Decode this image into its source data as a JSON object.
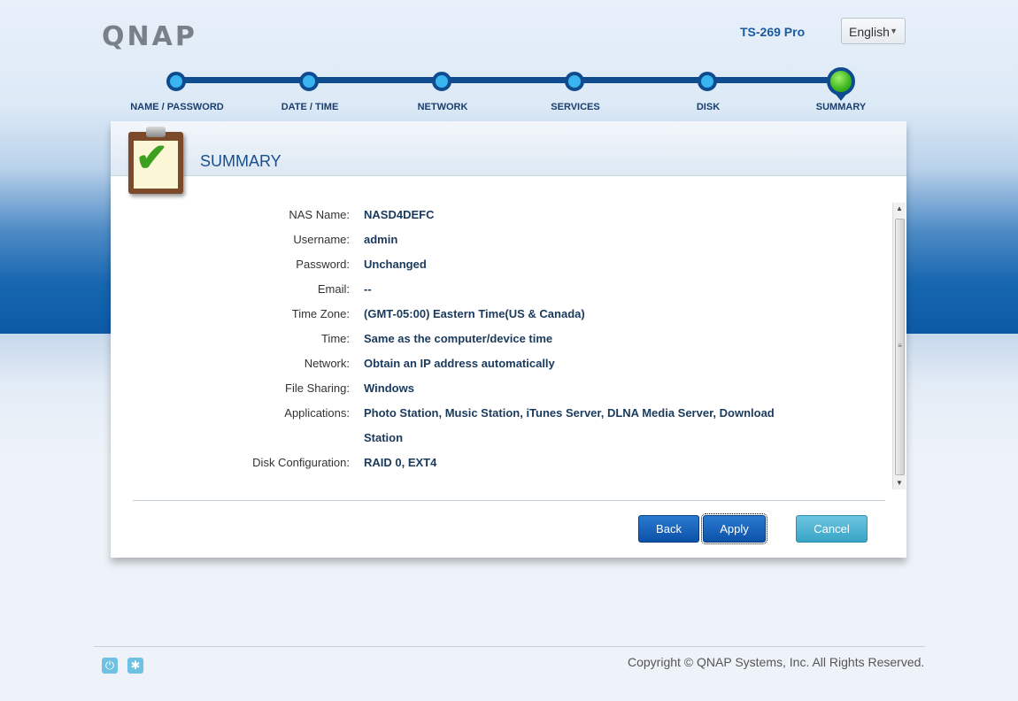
{
  "header": {
    "logo_text": "QNAP",
    "model": "TS-269 Pro",
    "language": "English"
  },
  "steps": [
    {
      "label": "NAME / PASSWORD",
      "active": false
    },
    {
      "label": "DATE / TIME",
      "active": false
    },
    {
      "label": "NETWORK",
      "active": false
    },
    {
      "label": "SERVICES",
      "active": false
    },
    {
      "label": "DISK",
      "active": false
    },
    {
      "label": "SUMMARY",
      "active": true
    }
  ],
  "panel": {
    "title": "SUMMARY",
    "icon": "clipboard-check-icon"
  },
  "summary": [
    {
      "label": "NAS Name:",
      "value": "NASD4DEFC"
    },
    {
      "label": "Username:",
      "value": "admin"
    },
    {
      "label": "Password:",
      "value": "Unchanged"
    },
    {
      "label": "Email:",
      "value": "--"
    },
    {
      "label": "Time Zone:",
      "value": "(GMT-05:00) Eastern Time(US & Canada)"
    },
    {
      "label": "Time:",
      "value": "Same as the computer/device time"
    },
    {
      "label": "Network:",
      "value": "Obtain an IP address automatically"
    },
    {
      "label": "File Sharing:",
      "value": "Windows"
    },
    {
      "label": "Applications:",
      "value": "Photo Station, Music Station, iTunes Server, DLNA Media Server, Download Station"
    },
    {
      "label": "Disk Configuration:",
      "value": "RAID 0, EXT4"
    }
  ],
  "buttons": {
    "back": "Back",
    "apply": "Apply",
    "cancel": "Cancel"
  },
  "footer": {
    "copyright": "Copyright © QNAP Systems, Inc. All Rights Reserved.",
    "icons": [
      "power-icon",
      "snowflake-icon"
    ]
  },
  "colors": {
    "accent": "#0f4c8f",
    "active_step": "#3cb51c",
    "step_dot": "#39b4ef",
    "button_primary": "#0c52a8",
    "button_secondary": "#3aa4c6"
  }
}
